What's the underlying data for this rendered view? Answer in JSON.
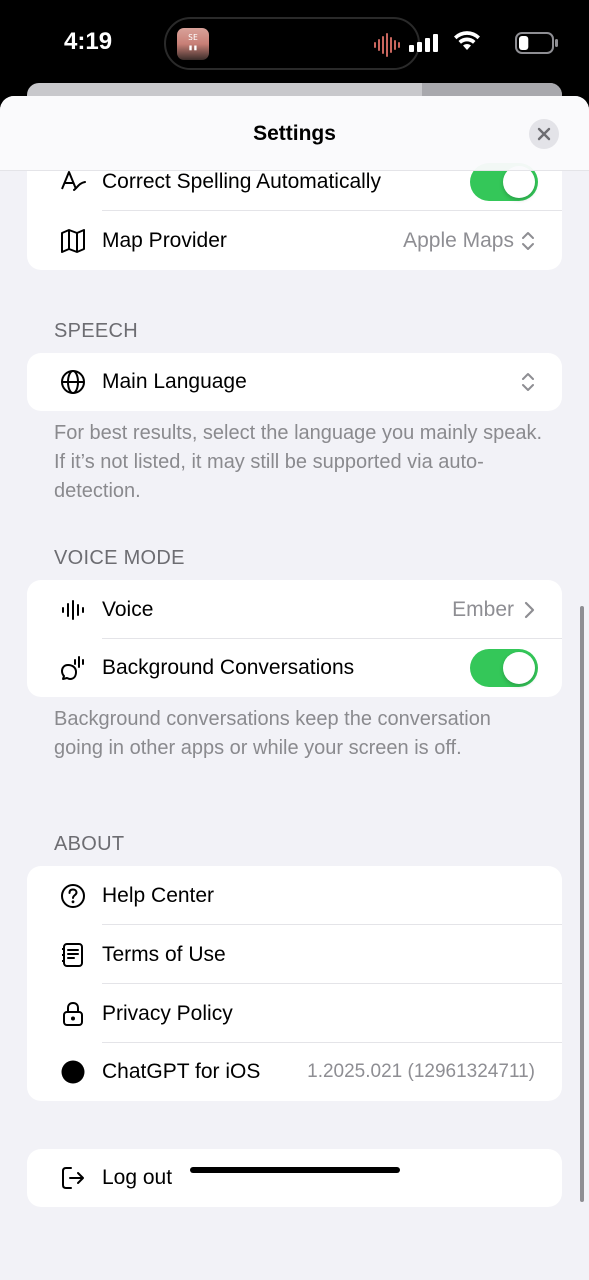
{
  "status_bar": {
    "time": "4:19",
    "island_thumb_text": "SE\n▮▮",
    "battery_level": 0.3
  },
  "header": {
    "title": "Settings"
  },
  "general": {
    "correct_spelling": {
      "label": "Correct Spelling Automatically",
      "enabled": true
    },
    "map_provider": {
      "label": "Map Provider",
      "value": "Apple Maps"
    }
  },
  "speech": {
    "header": "SPEECH",
    "main_language": {
      "label": "Main Language",
      "value": ""
    },
    "footnote": "For best results, select the language you mainly speak. If it’s not listed, it may still be supported via auto-detection."
  },
  "voice_mode": {
    "header": "VOICE MODE",
    "voice": {
      "label": "Voice",
      "value": "Ember"
    },
    "background": {
      "label": "Background Conversations",
      "enabled": true
    },
    "footnote": "Background conversations keep the conversation going in other apps or while your screen is off."
  },
  "about": {
    "header": "ABOUT",
    "items": [
      {
        "label": "Help Center",
        "icon": "question-circle-icon"
      },
      {
        "label": "Terms of Use",
        "icon": "document-icon"
      },
      {
        "label": "Privacy Policy",
        "icon": "lock-icon"
      },
      {
        "label": "ChatGPT for iOS",
        "icon": "chatgpt-logo-icon",
        "value": "1.2025.021 (12961324711)"
      }
    ]
  },
  "logout": {
    "label": "Log out"
  },
  "colors": {
    "toggle_on": "#34c759",
    "background": "#f2f2f7",
    "secondary_text": "#8e8e93"
  }
}
